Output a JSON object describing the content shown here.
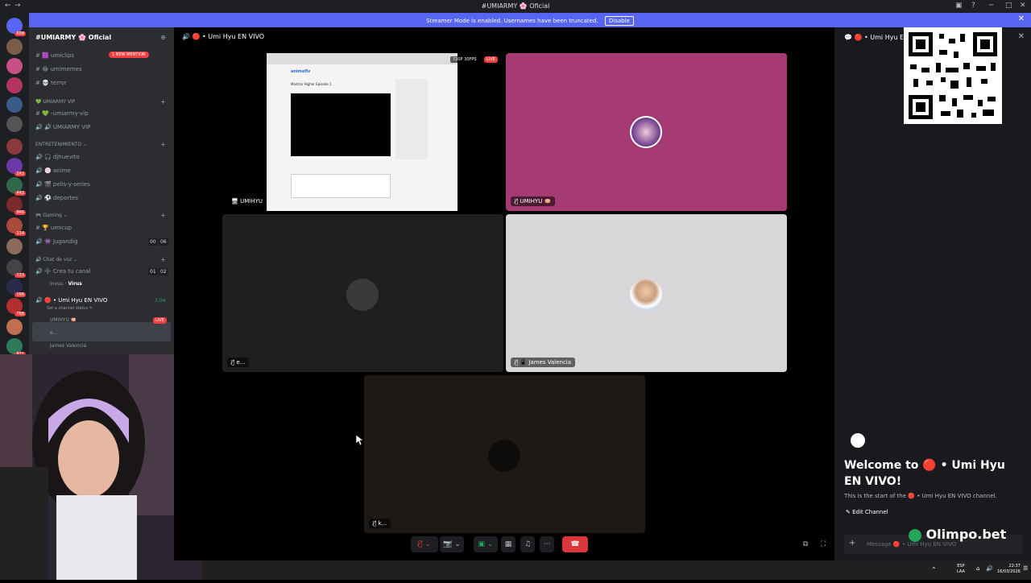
{
  "window": {
    "title": "#UMIARMY 🌸 Oficial"
  },
  "banner": {
    "text": "Streamer Mode is enabled. Usernames have been truncated.",
    "disable_label": "Disable"
  },
  "rail": {
    "badges": [
      "608",
      "142",
      "442",
      "946",
      "114",
      "123",
      "166",
      "768",
      "871"
    ]
  },
  "sidebar": {
    "guild_name": "#UMIARMY 🌸 Oficial",
    "mention_badge": "1 NEW MENTION",
    "channels_top": [
      "umiclips",
      "umimemes",
      "terror"
    ],
    "cat_vip": "UMIARMY VIP",
    "vip_channels": [
      "-umiarmy-vip",
      "UMIARMY VIP"
    ],
    "cat_ent": "ENTRETENIMIENTO",
    "ent_channels": [
      "djhuevito",
      "anime",
      "pelis-y-series",
      "deportes"
    ],
    "cat_gaming": "Gaming",
    "gaming_channels": [
      "umicup",
      "Jugandig"
    ],
    "gaming_counts": [
      "00",
      "06"
    ],
    "cat_voz": "Chat de voz",
    "voz_channel": "Crea tu canal",
    "voz_counts": [
      "01",
      "02"
    ],
    "voz_user": "Invuu",
    "voz_user_tag": "Virus",
    "active_channel": "Umi Hyu EN VIVO",
    "active_time": "3:04",
    "channel_status": "Set a channel status",
    "members": [
      "UMIHYU",
      "e...",
      "James Valencia"
    ],
    "live_label": "LIVE"
  },
  "stage": {
    "title": "Umi Hyu EN VIVO",
    "quality_badge": "720P 30FPS",
    "live_badge": "LIVE",
    "tiles": [
      {
        "name": "UMIHYU",
        "bg": "#1e1e1e"
      },
      {
        "name": "UMIHYU",
        "bg": "#a63a72"
      },
      {
        "name": "e...",
        "bg": "#1e1f1f"
      },
      {
        "name": "James Valencia",
        "bg": "#d8d6d8"
      },
      {
        "name": "k...",
        "bg": "#1c1916"
      }
    ],
    "screen_text": "Mostrar Higher Episode 1",
    "screen_logo": "animeflv"
  },
  "chat": {
    "header": "Umi Hyu EN VIVO",
    "welcome_title": "Welcome to 🔴 • Umi Hyu EN VIVO!",
    "welcome_sub": "This is the start of the 🔴 • Umi Hyu EN VIVO channel.",
    "edit_label": "Edit Channel",
    "message_placeholder": "Message 🔴 • Umi Hyu EN VIVO"
  },
  "overlay": {
    "brand": "Olimpo.bet"
  },
  "taskbar": {
    "lang": "ESP",
    "lang_sub": "LAA",
    "time": "22:37",
    "date": "16/03/2026"
  },
  "colors": {
    "accent": "#5865f2",
    "danger": "#f23f43",
    "online": "#23a55a"
  }
}
